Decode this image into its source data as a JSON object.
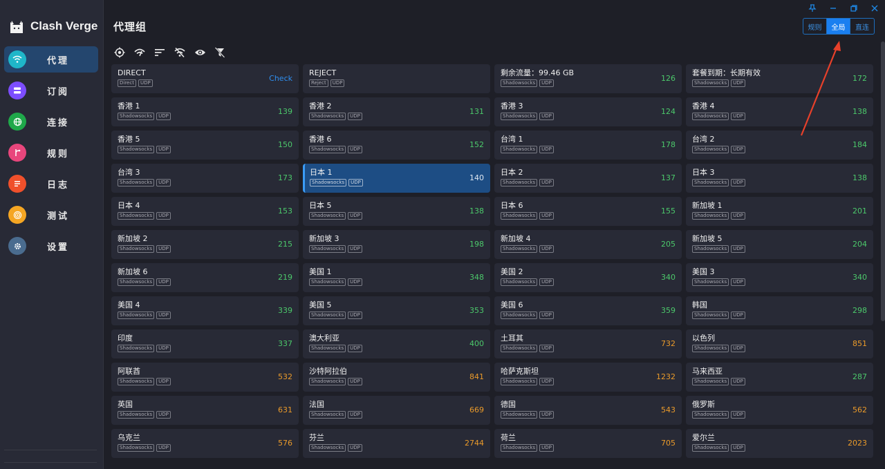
{
  "app": {
    "title": "Clash Verge"
  },
  "sidebar": {
    "items": [
      {
        "label": "代理",
        "icon": "wifi-icon",
        "color": "#1fb6c9",
        "active": true
      },
      {
        "label": "订阅",
        "icon": "subscription-icon",
        "color": "#7c4dff",
        "active": false
      },
      {
        "label": "连接",
        "icon": "globe-icon",
        "color": "#1fa84a",
        "active": false
      },
      {
        "label": "规则",
        "icon": "rules-icon",
        "color": "#e8467c",
        "active": false
      },
      {
        "label": "日志",
        "icon": "log-icon",
        "color": "#f0502b",
        "active": false
      },
      {
        "label": "测试",
        "icon": "test-icon",
        "color": "#f5a623",
        "active": false
      },
      {
        "label": "设置",
        "icon": "gear-icon",
        "color": "#4a6c8f",
        "active": false
      }
    ]
  },
  "header": {
    "title": "代理组",
    "modes": [
      {
        "label": "规则",
        "active": false
      },
      {
        "label": "全局",
        "active": true
      },
      {
        "label": "直连",
        "active": false
      }
    ]
  },
  "toolbar": {
    "icons": [
      "locate-icon",
      "speed-test-icon",
      "sort-icon",
      "filter-off-icon",
      "eye-icon",
      "url-filter-icon"
    ]
  },
  "proxies": [
    {
      "name": "DIRECT",
      "tags": [
        "Direct",
        "UDP"
      ],
      "delay": "Check",
      "delay_color": "blue"
    },
    {
      "name": "REJECT",
      "tags": [
        "Reject",
        "UDP"
      ],
      "delay": "",
      "delay_color": "green"
    },
    {
      "name": "剩余流量：99.46 GB",
      "tags": [
        "Shadowsocks",
        "UDP"
      ],
      "delay": "126",
      "delay_color": "green"
    },
    {
      "name": "套餐到期：长期有效",
      "tags": [
        "Shadowsocks",
        "UDP"
      ],
      "delay": "172",
      "delay_color": "green"
    },
    {
      "name": "香港 1",
      "tags": [
        "Shadowsocks",
        "UDP"
      ],
      "delay": "139",
      "delay_color": "green"
    },
    {
      "name": "香港 2",
      "tags": [
        "Shadowsocks",
        "UDP"
      ],
      "delay": "131",
      "delay_color": "green"
    },
    {
      "name": "香港 3",
      "tags": [
        "Shadowsocks",
        "UDP"
      ],
      "delay": "124",
      "delay_color": "green"
    },
    {
      "name": "香港 4",
      "tags": [
        "Shadowsocks",
        "UDP"
      ],
      "delay": "138",
      "delay_color": "green"
    },
    {
      "name": "香港 5",
      "tags": [
        "Shadowsocks",
        "UDP"
      ],
      "delay": "150",
      "delay_color": "green"
    },
    {
      "name": "香港 6",
      "tags": [
        "Shadowsocks",
        "UDP"
      ],
      "delay": "152",
      "delay_color": "green"
    },
    {
      "name": "台湾 1",
      "tags": [
        "Shadowsocks",
        "UDP"
      ],
      "delay": "178",
      "delay_color": "green"
    },
    {
      "name": "台湾 2",
      "tags": [
        "Shadowsocks",
        "UDP"
      ],
      "delay": "184",
      "delay_color": "green"
    },
    {
      "name": "台湾 3",
      "tags": [
        "Shadowsocks",
        "UDP"
      ],
      "delay": "173",
      "delay_color": "green"
    },
    {
      "name": "日本 1",
      "tags": [
        "Shadowsocks",
        "UDP"
      ],
      "delay": "140",
      "delay_color": "green",
      "selected": true
    },
    {
      "name": "日本 2",
      "tags": [
        "Shadowsocks",
        "UDP"
      ],
      "delay": "137",
      "delay_color": "green"
    },
    {
      "name": "日本 3",
      "tags": [
        "Shadowsocks",
        "UDP"
      ],
      "delay": "138",
      "delay_color": "green"
    },
    {
      "name": "日本 4",
      "tags": [
        "Shadowsocks",
        "UDP"
      ],
      "delay": "153",
      "delay_color": "green"
    },
    {
      "name": "日本 5",
      "tags": [
        "Shadowsocks",
        "UDP"
      ],
      "delay": "138",
      "delay_color": "green"
    },
    {
      "name": "日本 6",
      "tags": [
        "Shadowsocks",
        "UDP"
      ],
      "delay": "155",
      "delay_color": "green"
    },
    {
      "name": "新加坡 1",
      "tags": [
        "Shadowsocks",
        "UDP"
      ],
      "delay": "201",
      "delay_color": "green"
    },
    {
      "name": "新加坡 2",
      "tags": [
        "Shadowsocks",
        "UDP"
      ],
      "delay": "215",
      "delay_color": "green"
    },
    {
      "name": "新加坡 3",
      "tags": [
        "Shadowsocks",
        "UDP"
      ],
      "delay": "198",
      "delay_color": "green"
    },
    {
      "name": "新加坡 4",
      "tags": [
        "Shadowsocks",
        "UDP"
      ],
      "delay": "205",
      "delay_color": "green"
    },
    {
      "name": "新加坡 5",
      "tags": [
        "Shadowsocks",
        "UDP"
      ],
      "delay": "204",
      "delay_color": "green"
    },
    {
      "name": "新加坡 6",
      "tags": [
        "Shadowsocks",
        "UDP"
      ],
      "delay": "219",
      "delay_color": "green"
    },
    {
      "name": "美国 1",
      "tags": [
        "Shadowsocks",
        "UDP"
      ],
      "delay": "348",
      "delay_color": "green"
    },
    {
      "name": "美国 2",
      "tags": [
        "Shadowsocks",
        "UDP"
      ],
      "delay": "340",
      "delay_color": "green"
    },
    {
      "name": "美国 3",
      "tags": [
        "Shadowsocks",
        "UDP"
      ],
      "delay": "340",
      "delay_color": "green"
    },
    {
      "name": "美国 4",
      "tags": [
        "Shadowsocks",
        "UDP"
      ],
      "delay": "339",
      "delay_color": "green"
    },
    {
      "name": "美国 5",
      "tags": [
        "Shadowsocks",
        "UDP"
      ],
      "delay": "353",
      "delay_color": "green"
    },
    {
      "name": "美国 6",
      "tags": [
        "Shadowsocks",
        "UDP"
      ],
      "delay": "359",
      "delay_color": "green"
    },
    {
      "name": "韩国",
      "tags": [
        "Shadowsocks",
        "UDP"
      ],
      "delay": "298",
      "delay_color": "green"
    },
    {
      "name": "印度",
      "tags": [
        "Shadowsocks",
        "UDP"
      ],
      "delay": "337",
      "delay_color": "green"
    },
    {
      "name": "澳大利亚",
      "tags": [
        "Shadowsocks",
        "UDP"
      ],
      "delay": "400",
      "delay_color": "green"
    },
    {
      "name": "土耳其",
      "tags": [
        "Shadowsocks",
        "UDP"
      ],
      "delay": "732",
      "delay_color": "orange"
    },
    {
      "name": "以色列",
      "tags": [
        "Shadowsocks",
        "UDP"
      ],
      "delay": "851",
      "delay_color": "orange"
    },
    {
      "name": "阿联酋",
      "tags": [
        "Shadowsocks",
        "UDP"
      ],
      "delay": "532",
      "delay_color": "orange"
    },
    {
      "name": "沙特阿拉伯",
      "tags": [
        "Shadowsocks",
        "UDP"
      ],
      "delay": "841",
      "delay_color": "orange"
    },
    {
      "name": "哈萨克斯坦",
      "tags": [
        "Shadowsocks",
        "UDP"
      ],
      "delay": "1232",
      "delay_color": "orange"
    },
    {
      "name": "马来西亚",
      "tags": [
        "Shadowsocks",
        "UDP"
      ],
      "delay": "287",
      "delay_color": "green"
    },
    {
      "name": "英国",
      "tags": [
        "Shadowsocks",
        "UDP"
      ],
      "delay": "631",
      "delay_color": "orange"
    },
    {
      "name": "法国",
      "tags": [
        "Shadowsocks",
        "UDP"
      ],
      "delay": "669",
      "delay_color": "orange"
    },
    {
      "name": "德国",
      "tags": [
        "Shadowsocks",
        "UDP"
      ],
      "delay": "543",
      "delay_color": "orange"
    },
    {
      "name": "俄罗斯",
      "tags": [
        "Shadowsocks",
        "UDP"
      ],
      "delay": "562",
      "delay_color": "orange"
    },
    {
      "name": "乌克兰",
      "tags": [
        "Shadowsocks",
        "UDP"
      ],
      "delay": "576",
      "delay_color": "orange"
    },
    {
      "name": "芬兰",
      "tags": [
        "Shadowsocks",
        "UDP"
      ],
      "delay": "2744",
      "delay_color": "orange"
    },
    {
      "name": "荷兰",
      "tags": [
        "Shadowsocks",
        "UDP"
      ],
      "delay": "705",
      "delay_color": "orange"
    },
    {
      "name": "爱尔兰",
      "tags": [
        "Shadowsocks",
        "UDP"
      ],
      "delay": "2023",
      "delay_color": "orange"
    }
  ]
}
